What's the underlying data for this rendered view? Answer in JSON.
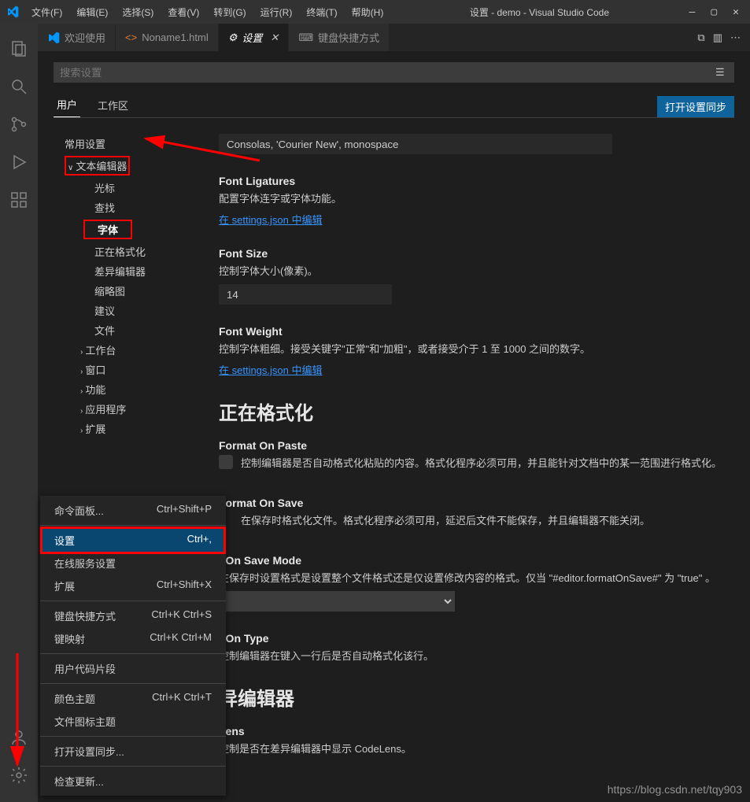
{
  "titlebar": {
    "title": "设置 - demo - Visual Studio Code",
    "menus": [
      "文件(F)",
      "编辑(E)",
      "选择(S)",
      "查看(V)",
      "转到(G)",
      "运行(R)",
      "终端(T)",
      "帮助(H)"
    ]
  },
  "tabs": [
    {
      "label": "欢迎使用",
      "icon": "vscode"
    },
    {
      "label": "Noname1.html",
      "icon": "html"
    },
    {
      "label": "设置",
      "icon": "gear",
      "active": true
    },
    {
      "label": "键盘快捷方式",
      "icon": "keyboard"
    }
  ],
  "settings": {
    "search_placeholder": "搜索设置",
    "scope_user": "用户",
    "scope_workspace": "工作区",
    "sync_button": "打开设置同步"
  },
  "toc": {
    "common": "常用设置",
    "text_editor": "文本编辑器",
    "cursor": "光标",
    "find": "查找",
    "font": "字体",
    "formatting": "正在格式化",
    "diff": "差异编辑器",
    "minimap": "缩略图",
    "suggest": "建议",
    "files": "文件",
    "workbench": "工作台",
    "window": "窗口",
    "features": "功能",
    "application": "应用程序",
    "extensions": "扩展"
  },
  "content": {
    "font_family_value": "Consolas, 'Courier New', monospace",
    "font_ligatures_title": "Font Ligatures",
    "font_ligatures_desc": "配置字体连字或字体功能。",
    "edit_in_json": "在 settings.json 中编辑",
    "font_size_title": "Font Size",
    "font_size_desc": "控制字体大小(像素)。",
    "font_size_value": "14",
    "font_weight_title": "Font Weight",
    "font_weight_desc": "控制字体粗细。接受关键字\"正常\"和\"加粗\"，或者接受介于 1 至 1000 之间的数字。",
    "formatting_header": "正在格式化",
    "format_on_paste_title": "Format On Paste",
    "format_on_paste_desc": "控制编辑器是否自动格式化粘贴的内容。格式化程序必须可用，并且能针对文档中的某一范围进行格式化。",
    "format_on_save_title": "Format On Save",
    "format_on_save_desc": "在保存时格式化文件。格式化程序必须可用，延迟后文件不能保存，并且编辑器不能关闭。",
    "format_on_save_mode_title": "t On Save Mode",
    "format_on_save_mode_desc": "在保存时设置格式是设置整个文件格式还是仅设置修改内容的格式。仅当 \"#editor.formatOnSave#\" 为 \"true\" 。",
    "format_on_type_title": "t On Type",
    "format_on_type_desc": "控制编辑器在键入一行后是否自动格式化该行。",
    "diff_header": "异编辑器",
    "codelens_title": "Lens",
    "codelens_desc": "控制是否在差异编辑器中显示 CodeLens。"
  },
  "context_menu": {
    "items": [
      {
        "label": "命令面板...",
        "shortcut": "Ctrl+Shift+P"
      },
      {
        "sep": true
      },
      {
        "label": "设置",
        "shortcut": "Ctrl+,",
        "selected": true
      },
      {
        "label": "在线服务设置",
        "shortcut": ""
      },
      {
        "label": "扩展",
        "shortcut": "Ctrl+Shift+X"
      },
      {
        "sep": true
      },
      {
        "label": "键盘快捷方式",
        "shortcut": "Ctrl+K Ctrl+S"
      },
      {
        "label": "键映射",
        "shortcut": "Ctrl+K Ctrl+M"
      },
      {
        "sep": true
      },
      {
        "label": "用户代码片段",
        "shortcut": ""
      },
      {
        "sep": true
      },
      {
        "label": "颜色主题",
        "shortcut": "Ctrl+K Ctrl+T"
      },
      {
        "label": "文件图标主题",
        "shortcut": ""
      },
      {
        "sep": true
      },
      {
        "label": "打开设置同步...",
        "shortcut": ""
      },
      {
        "sep": true
      },
      {
        "label": "检查更新...",
        "shortcut": ""
      }
    ]
  },
  "watermark": "https://blog.csdn.net/tqy903"
}
